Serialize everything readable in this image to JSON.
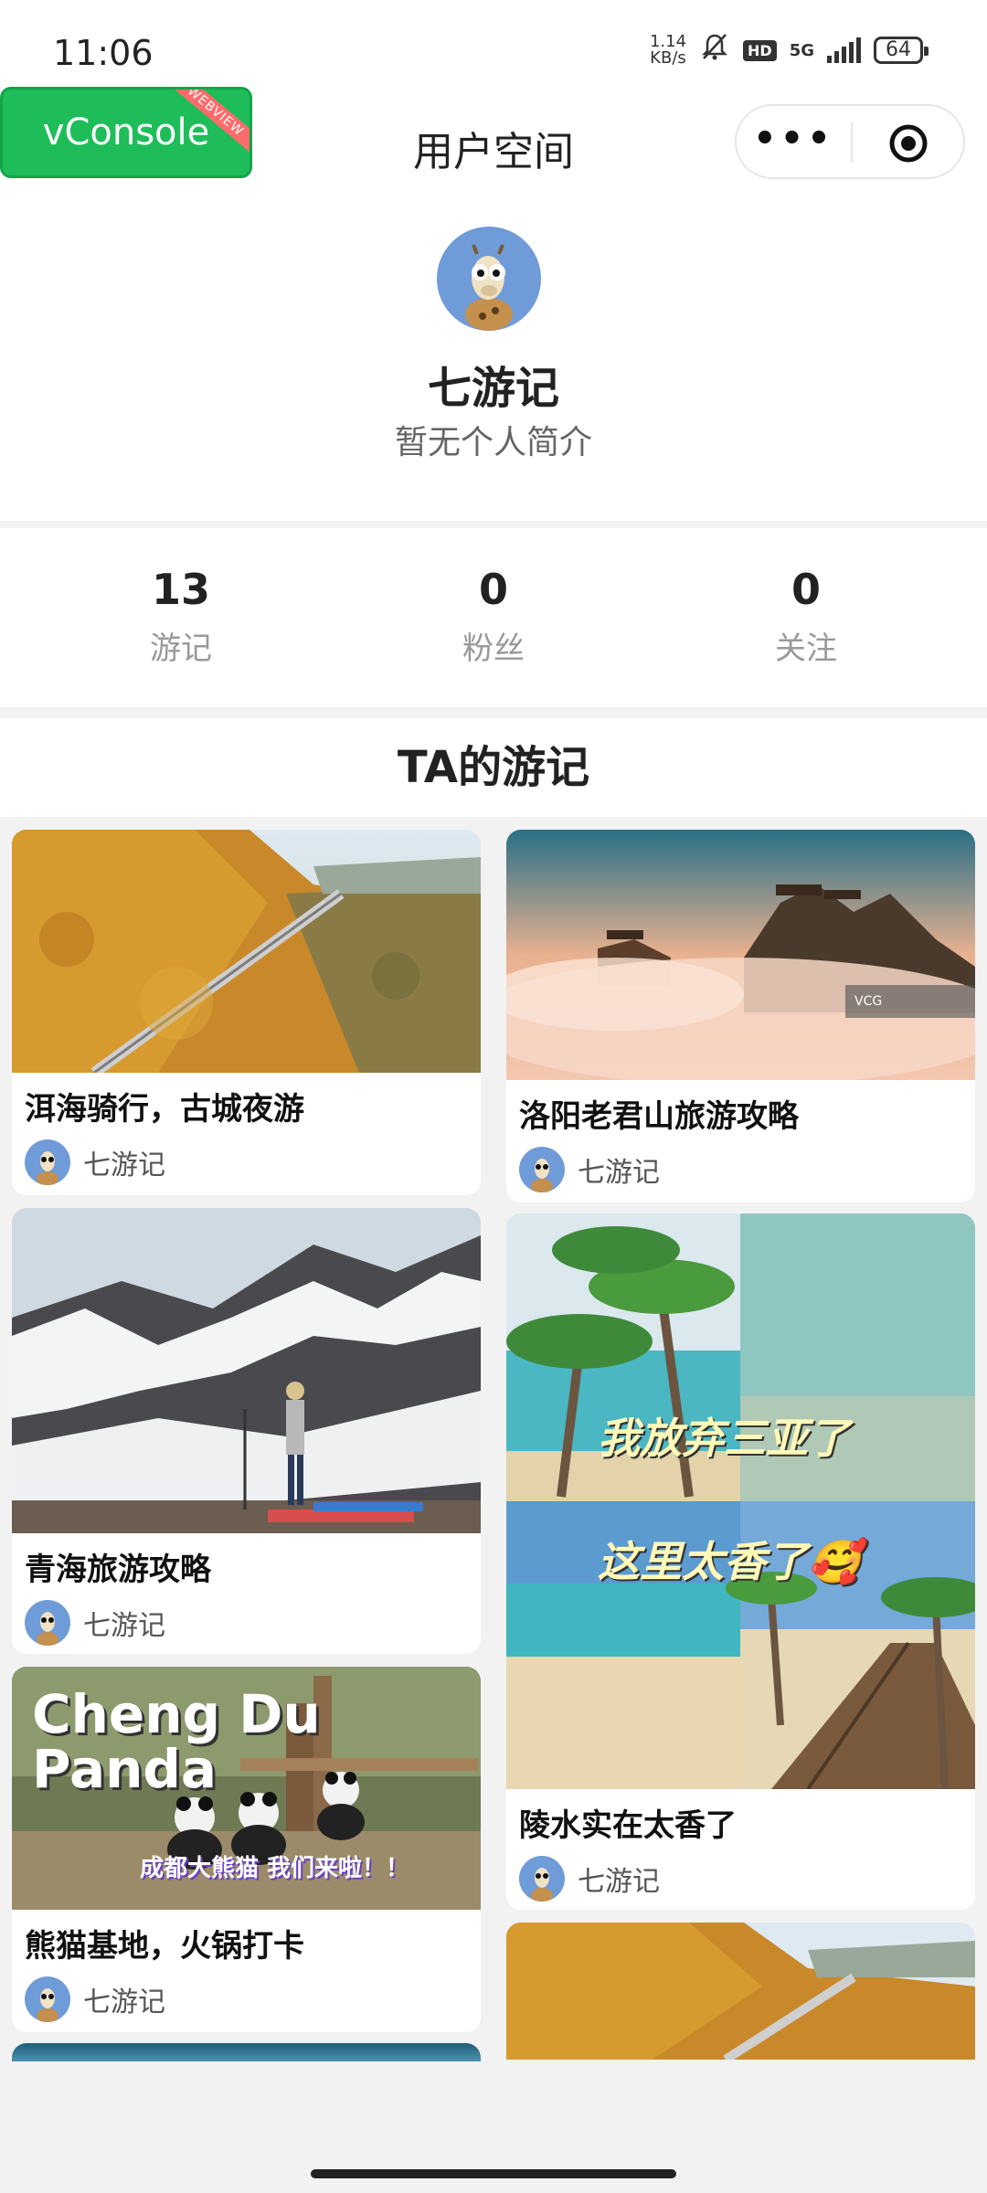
{
  "status": {
    "time": "11:06",
    "net_speed_value": "1.14",
    "net_speed_unit": "KB/s",
    "mute_icon": "bell-off-icon",
    "hd_label": "HD",
    "network_label": "5G",
    "battery": "64"
  },
  "vconsole": {
    "label": "vConsole",
    "ribbon": "WEBVIEW"
  },
  "nav": {
    "title": "用户空间",
    "more_label": "•••"
  },
  "profile": {
    "name": "七游记",
    "bio": "暂无个人简介"
  },
  "stats": [
    {
      "value": "13",
      "label": "游记"
    },
    {
      "value": "0",
      "label": "粉丝"
    },
    {
      "value": "0",
      "label": "关注"
    }
  ],
  "section": {
    "title": "TA的游记"
  },
  "cards": [
    {
      "title": "洱海骑行，古城夜游",
      "author": "七游记"
    },
    {
      "title": "洛阳老君山旅游攻略",
      "author": "七游记"
    },
    {
      "title": "青海旅游攻略",
      "author": "七游记"
    },
    {
      "title": "陵水实在太香了",
      "author": "七游记"
    },
    {
      "title": "熊猫基地，火锅打卡",
      "author": "七游记"
    }
  ],
  "overlays": {
    "sanya_1": "我放弃三亚了",
    "sanya_2": "这里太香了🥰",
    "panda_en": "Cheng Du\nPanda",
    "panda_cn": "成都大熊猫 我们来啦！！",
    "luoyang_watermark": "VCG"
  },
  "colors": {
    "vconsole_green": "#1ebd5a",
    "page_bg": "#f2f2f2"
  }
}
